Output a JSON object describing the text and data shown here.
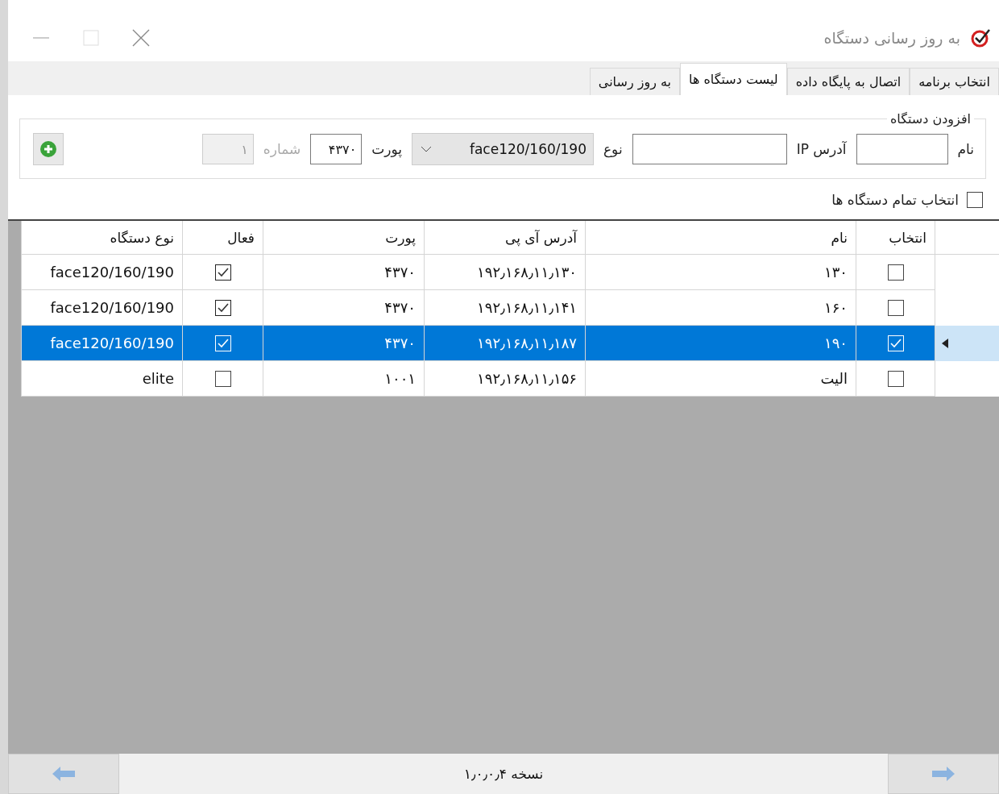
{
  "window": {
    "title": "به روز رسانی دستگاه"
  },
  "tabs": [
    {
      "label": "انتخاب برنامه",
      "selected": false
    },
    {
      "label": "اتصال به پایگاه داده",
      "selected": false
    },
    {
      "label": "لیست دستگاه ها",
      "selected": true
    },
    {
      "label": "به روز رسانی",
      "selected": false
    }
  ],
  "add_device": {
    "title": "افزودن دستگاه",
    "name_label": "نام",
    "ip_label": "آدرس IP",
    "type_label": "نوع",
    "type_value": "face120/160/190",
    "port_label": "پورت",
    "port_value": "۴۳۷۰",
    "number_label": "شماره",
    "number_value": "۱"
  },
  "select_all": {
    "label": "انتخاب تمام دستگاه ها",
    "checked": false
  },
  "table": {
    "columns": [
      "انتخاب",
      "نام",
      "آدرس آی پی",
      "پورت",
      "فعال",
      "نوع دستگاه"
    ],
    "rows": [
      {
        "selected": false,
        "checked": false,
        "name": "۱۳۰",
        "ip": "۱۹۲٫۱۶۸٫۱۱٫۱۳۰",
        "port": "۴۳۷۰",
        "active": true,
        "type": "face120/160/190"
      },
      {
        "selected": false,
        "checked": false,
        "name": "۱۶۰",
        "ip": "۱۹۲٫۱۶۸٫۱۱٫۱۴۱",
        "port": "۴۳۷۰",
        "active": true,
        "type": "face120/160/190"
      },
      {
        "selected": true,
        "checked": true,
        "name": "۱۹۰",
        "ip": "۱۹۲٫۱۶۸٫۱۱٫۱۸۷",
        "port": "۴۳۷۰",
        "active": true,
        "type": "face120/160/190"
      },
      {
        "selected": false,
        "checked": false,
        "name": "الیت",
        "ip": "۱۹۲٫۱۶۸٫۱۱٫۱۵۶",
        "port": "۱۰۰۱",
        "active": false,
        "type": "elite"
      }
    ]
  },
  "footer": {
    "version": "نسخه ۱٫۰٫۰٫۴"
  }
}
